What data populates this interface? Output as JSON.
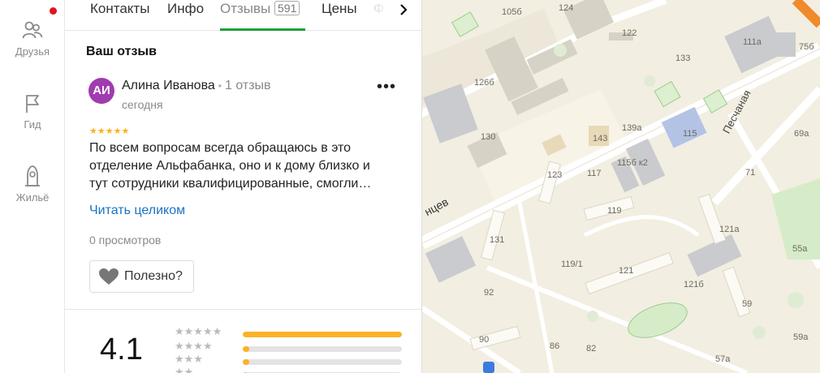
{
  "rail": {
    "items": [
      {
        "label": "Друзья",
        "icon": "friends-icon"
      },
      {
        "label": "Гид",
        "icon": "flag-icon"
      },
      {
        "label": "Жильё",
        "icon": "house-icon"
      }
    ]
  },
  "tabs": {
    "items": [
      {
        "label": "Контакты"
      },
      {
        "label": "Инфо"
      },
      {
        "label": "Отзывы",
        "count": "591",
        "active": true
      },
      {
        "label": "Цены"
      },
      {
        "label": "Ф"
      }
    ]
  },
  "review_section": {
    "title": "Ваш отзыв",
    "author": {
      "initials": "АИ",
      "name": "Алина Иванова",
      "reviews_count": "1 отзыв",
      "date": "сегодня"
    },
    "stars": "★★★★★",
    "rating": 5,
    "text_lines": [
      "По всем вопросам всегда обращаюсь в это",
      "отделение Альфабанка, оно и к дому близко и",
      "тут сотрудники квалифицированные, смогли…"
    ],
    "read_more": "Читать целиком",
    "views": "0 просмотров",
    "helpful_label": "Полезно?"
  },
  "summary": {
    "average": "4.1",
    "rows": [
      {
        "stars": "★★★★★",
        "fraction": 1.0
      },
      {
        "stars": "★★★★",
        "fraction": 0.04
      },
      {
        "stars": "★★★",
        "fraction": 0.04
      },
      {
        "stars": "★★",
        "fraction": 0.03
      }
    ]
  },
  "map": {
    "labels": [
      "105б",
      "124",
      "122",
      "133",
      "111а",
      "75б",
      "126б",
      "139а",
      "115",
      "69а",
      "130",
      "143",
      "123",
      "117",
      "115б к2",
      "71",
      "119",
      "131",
      "121а",
      "119/1",
      "121",
      "121б",
      "55а",
      "92",
      "59",
      "90",
      "86",
      "82",
      "57а",
      "59а",
      "Песчаная",
      "нцев"
    ]
  },
  "colors": {
    "accent_green": "#21a038",
    "link_blue": "#1a73c2",
    "star_yellow": "#fbb226",
    "avatar_purple": "#a13bb0",
    "badge_red": "#e1141e"
  }
}
